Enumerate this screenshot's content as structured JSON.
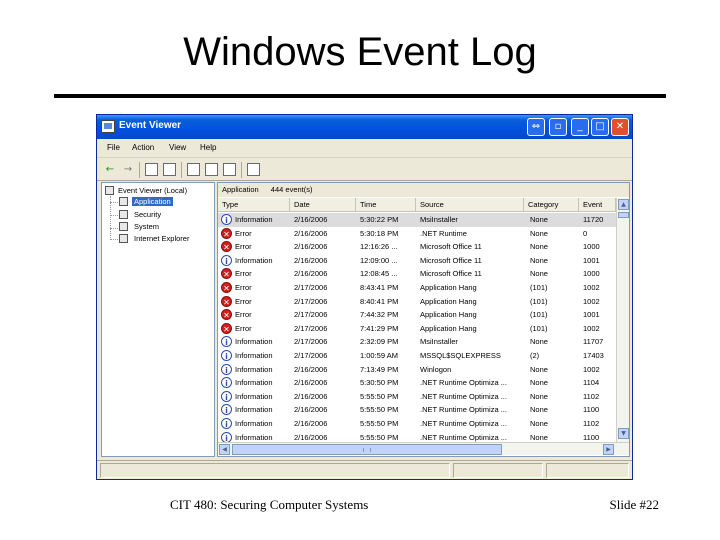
{
  "slide": {
    "title": "Windows Event Log",
    "footer_left": "CIT 480: Securing Computer Systems",
    "footer_right": "Slide #22"
  },
  "window": {
    "title": "Event Viewer",
    "menu": [
      "File",
      "Action",
      "View",
      "Help"
    ]
  },
  "tree": {
    "root": "Event Viewer (Local)",
    "items": [
      "Application",
      "Security",
      "System",
      "Internet Explorer"
    ],
    "selected": "Application"
  },
  "list": {
    "caption_name": "Application",
    "caption_count": "444 event(s)",
    "columns": [
      "Type",
      "Date",
      "Time",
      "Source",
      "Category",
      "Event"
    ],
    "rows": [
      {
        "type": "Information",
        "icon": "info",
        "date": "2/16/2006",
        "time": "5:30:22 PM",
        "source": "MsiInstaller",
        "category": "None",
        "event": "11720"
      },
      {
        "type": "Error",
        "icon": "error",
        "date": "2/16/2006",
        "time": "5:30:18 PM",
        "source": ".NET Runtime",
        "category": "None",
        "event": "0"
      },
      {
        "type": "Error",
        "icon": "error",
        "date": "2/16/2006",
        "time": "12:16:26 ...",
        "source": "Microsoft Office 11",
        "category": "None",
        "event": "1000"
      },
      {
        "type": "Information",
        "icon": "info",
        "date": "2/16/2006",
        "time": "12:09:00 ...",
        "source": "Microsoft Office 11",
        "category": "None",
        "event": "1001"
      },
      {
        "type": "Error",
        "icon": "error",
        "date": "2/16/2006",
        "time": "12:08:45 ...",
        "source": "Microsoft Office 11",
        "category": "None",
        "event": "1000"
      },
      {
        "type": "Error",
        "icon": "error",
        "date": "2/17/2006",
        "time": "8:43:41 PM",
        "source": "Application Hang",
        "category": "(101)",
        "event": "1002"
      },
      {
        "type": "Error",
        "icon": "error",
        "date": "2/17/2006",
        "time": "8:40:41 PM",
        "source": "Application Hang",
        "category": "(101)",
        "event": "1002"
      },
      {
        "type": "Error",
        "icon": "error",
        "date": "2/17/2006",
        "time": "7:44:32 PM",
        "source": "Application Hang",
        "category": "(101)",
        "event": "1001"
      },
      {
        "type": "Error",
        "icon": "error",
        "date": "2/17/2006",
        "time": "7:41:29 PM",
        "source": "Application Hang",
        "category": "(101)",
        "event": "1002"
      },
      {
        "type": "Information",
        "icon": "info",
        "date": "2/17/2006",
        "time": "2:32:09 PM",
        "source": "MsiInstaller",
        "category": "None",
        "event": "11707"
      },
      {
        "type": "Information",
        "icon": "info",
        "date": "2/17/2006",
        "time": "1:00:59 AM",
        "source": "MSSQL$SQLEXPRESS",
        "category": "(2)",
        "event": "17403"
      },
      {
        "type": "Information",
        "icon": "info",
        "date": "2/16/2006",
        "time": "7:13:49 PM",
        "source": "Winlogon",
        "category": "None",
        "event": "1002"
      },
      {
        "type": "Information",
        "icon": "info",
        "date": "2/16/2006",
        "time": "5:30:50 PM",
        "source": ".NET Runtime Optimiza ...",
        "category": "None",
        "event": "1104"
      },
      {
        "type": "Information",
        "icon": "info",
        "date": "2/16/2006",
        "time": "5:55:50 PM",
        "source": ".NET Runtime Optimiza ...",
        "category": "None",
        "event": "1102"
      },
      {
        "type": "Information",
        "icon": "info",
        "date": "2/16/2006",
        "time": "5:55:50 PM",
        "source": ".NET Runtime Optimiza ...",
        "category": "None",
        "event": "1100"
      },
      {
        "type": "Information",
        "icon": "info",
        "date": "2/16/2006",
        "time": "5:55:50 PM",
        "source": ".NET Runtime Optimiza ...",
        "category": "None",
        "event": "1102"
      },
      {
        "type": "Information",
        "icon": "info",
        "date": "2/16/2006",
        "time": "5:55:50 PM",
        "source": ".NET Runtime Optimiza ...",
        "category": "None",
        "event": "1100"
      }
    ]
  },
  "colors": {
    "titlebar": "#0050e0",
    "selection": "#316ac5",
    "error_icon": "#d3201c",
    "info_icon": "#2a4fa8"
  },
  "icons": {
    "error": "error-icon",
    "info": "information-icon"
  }
}
